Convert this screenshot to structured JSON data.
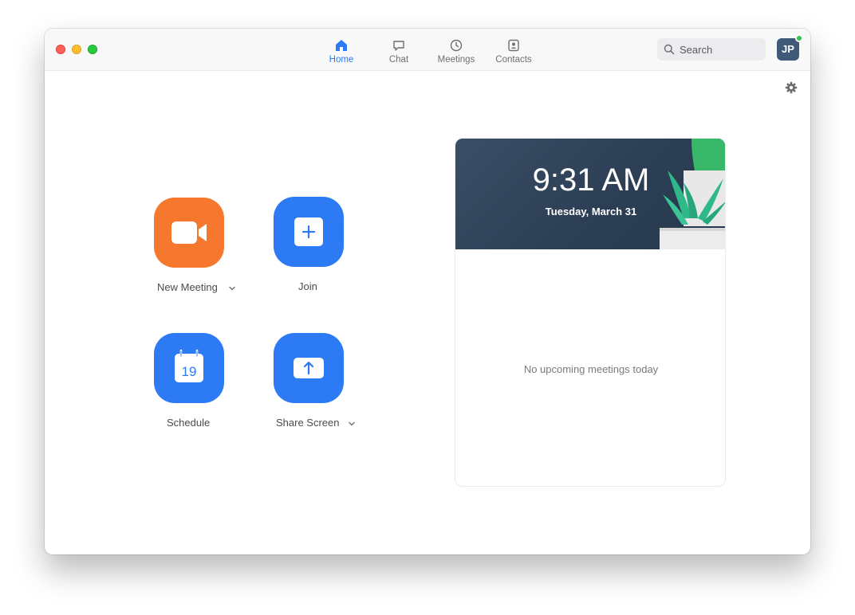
{
  "window": {
    "traffic_lights": {
      "close": "#fe5f57",
      "minimize": "#febc2e",
      "maximize": "#28c840"
    }
  },
  "nav": {
    "tabs": [
      {
        "id": "home",
        "label": "Home",
        "icon": "home-icon",
        "active": true
      },
      {
        "id": "chat",
        "label": "Chat",
        "icon": "chat-bubble-icon",
        "active": false
      },
      {
        "id": "meetings",
        "label": "Meetings",
        "icon": "clock-icon",
        "active": false
      },
      {
        "id": "contacts",
        "label": "Contacts",
        "icon": "contact-card-icon",
        "active": false
      }
    ],
    "active_color": "#2d7bf4"
  },
  "search": {
    "placeholder": "Search",
    "icon": "search-icon"
  },
  "user": {
    "initials": "JP",
    "status": "online",
    "status_color": "#2fc35a",
    "avatar_color": "#3f5a78"
  },
  "settings": {
    "icon": "gear-icon"
  },
  "actions": [
    {
      "id": "new-meeting",
      "label": "New Meeting",
      "icon": "video-camera-icon",
      "color": "#f5782e",
      "has_dropdown": true
    },
    {
      "id": "join",
      "label": "Join",
      "icon": "plus-icon",
      "color": "#2d7bf4",
      "has_dropdown": false
    },
    {
      "id": "schedule",
      "label": "Schedule",
      "icon": "calendar-icon",
      "calendar_day": "19",
      "color": "#2d7bf4",
      "has_dropdown": false
    },
    {
      "id": "share-screen",
      "label": "Share Screen",
      "icon": "share-arrow-up-icon",
      "color": "#2d7bf4",
      "has_dropdown": true
    }
  ],
  "calendar_card": {
    "time": "9:31 AM",
    "date": "Tuesday, March 31",
    "empty_message": "No upcoming meetings today"
  }
}
